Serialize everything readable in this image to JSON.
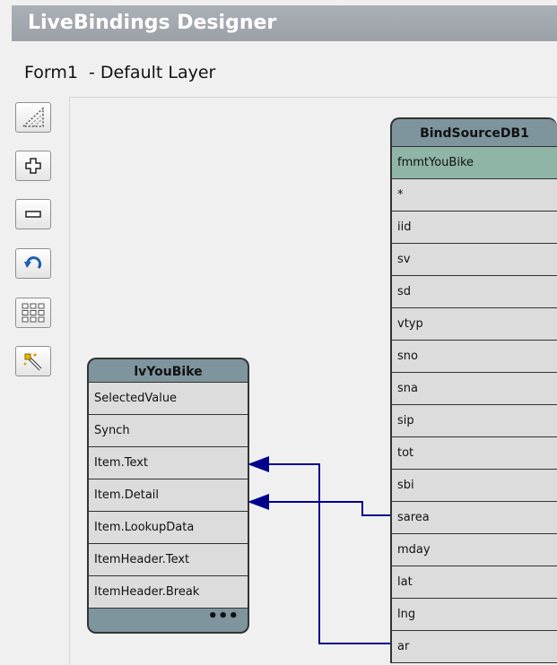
{
  "window": {
    "title": "LiveBindings Designer"
  },
  "layer": {
    "label": "Form1  - Default Layer"
  },
  "toolbar": {
    "buttons": [
      {
        "name": "layout-icon"
      },
      {
        "name": "zoom-in-icon"
      },
      {
        "name": "zoom-out-icon"
      },
      {
        "name": "undo-icon"
      },
      {
        "name": "grid-icon"
      },
      {
        "name": "magic-wand-icon"
      }
    ]
  },
  "left_node": {
    "title": "lvYouBike",
    "rows": [
      "SelectedValue",
      "Synch",
      "Item.Text",
      "Item.Detail",
      "Item.LookupData",
      "ItemHeader.Text",
      "ItemHeader.Break"
    ],
    "more": "•••"
  },
  "right_node": {
    "title": "BindSourceDB1",
    "rows": [
      "fmmtYouBike",
      "*",
      "iid",
      "sv",
      "sd",
      "vtyp",
      "sno",
      "sna",
      "sip",
      "tot",
      "sbi",
      "sarea",
      "mday",
      "lat",
      "lng",
      "ar"
    ]
  },
  "colors": {
    "link": "#00008b",
    "header": "#7e959e",
    "highlight": "#8fb5a7"
  }
}
